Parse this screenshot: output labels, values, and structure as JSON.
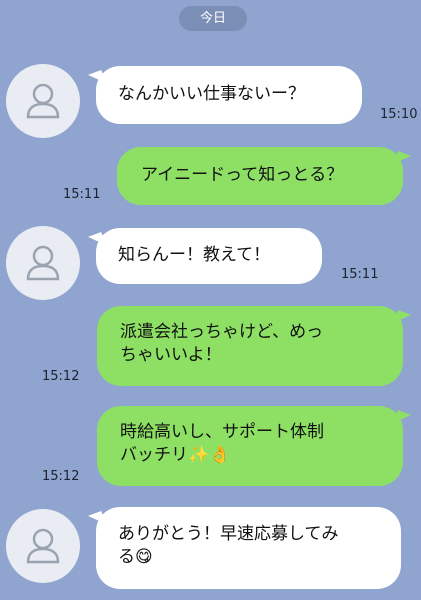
{
  "date_label": "今日",
  "messages": [
    {
      "side": "in",
      "text": "なんかいい仕事ないー？",
      "time": "15:10"
    },
    {
      "side": "out",
      "text": "アイニードって知っとる？",
      "time": "15:11"
    },
    {
      "side": "in",
      "text": "知らんー！教えて！",
      "time": "15:11"
    },
    {
      "side": "out",
      "line1": "派遣会社っちゃけど、めっ",
      "line2": "ちゃいいよ！",
      "time": "15:12"
    },
    {
      "side": "out",
      "line1": "時給高いし、サポート体制",
      "line2": "バッチリ",
      "emoji": "✨👌",
      "time": "15:12"
    },
    {
      "side": "in",
      "line1": "ありがとう！早速応募してみ",
      "line2": "る",
      "emoji": "😋"
    }
  ],
  "colors": {
    "background": "#8fa5cf",
    "incoming_bubble": "#ffffff",
    "outgoing_bubble": "#8de064",
    "avatar": "#e9ecf2"
  },
  "icons": {
    "avatar": "person-silhouette-icon"
  }
}
